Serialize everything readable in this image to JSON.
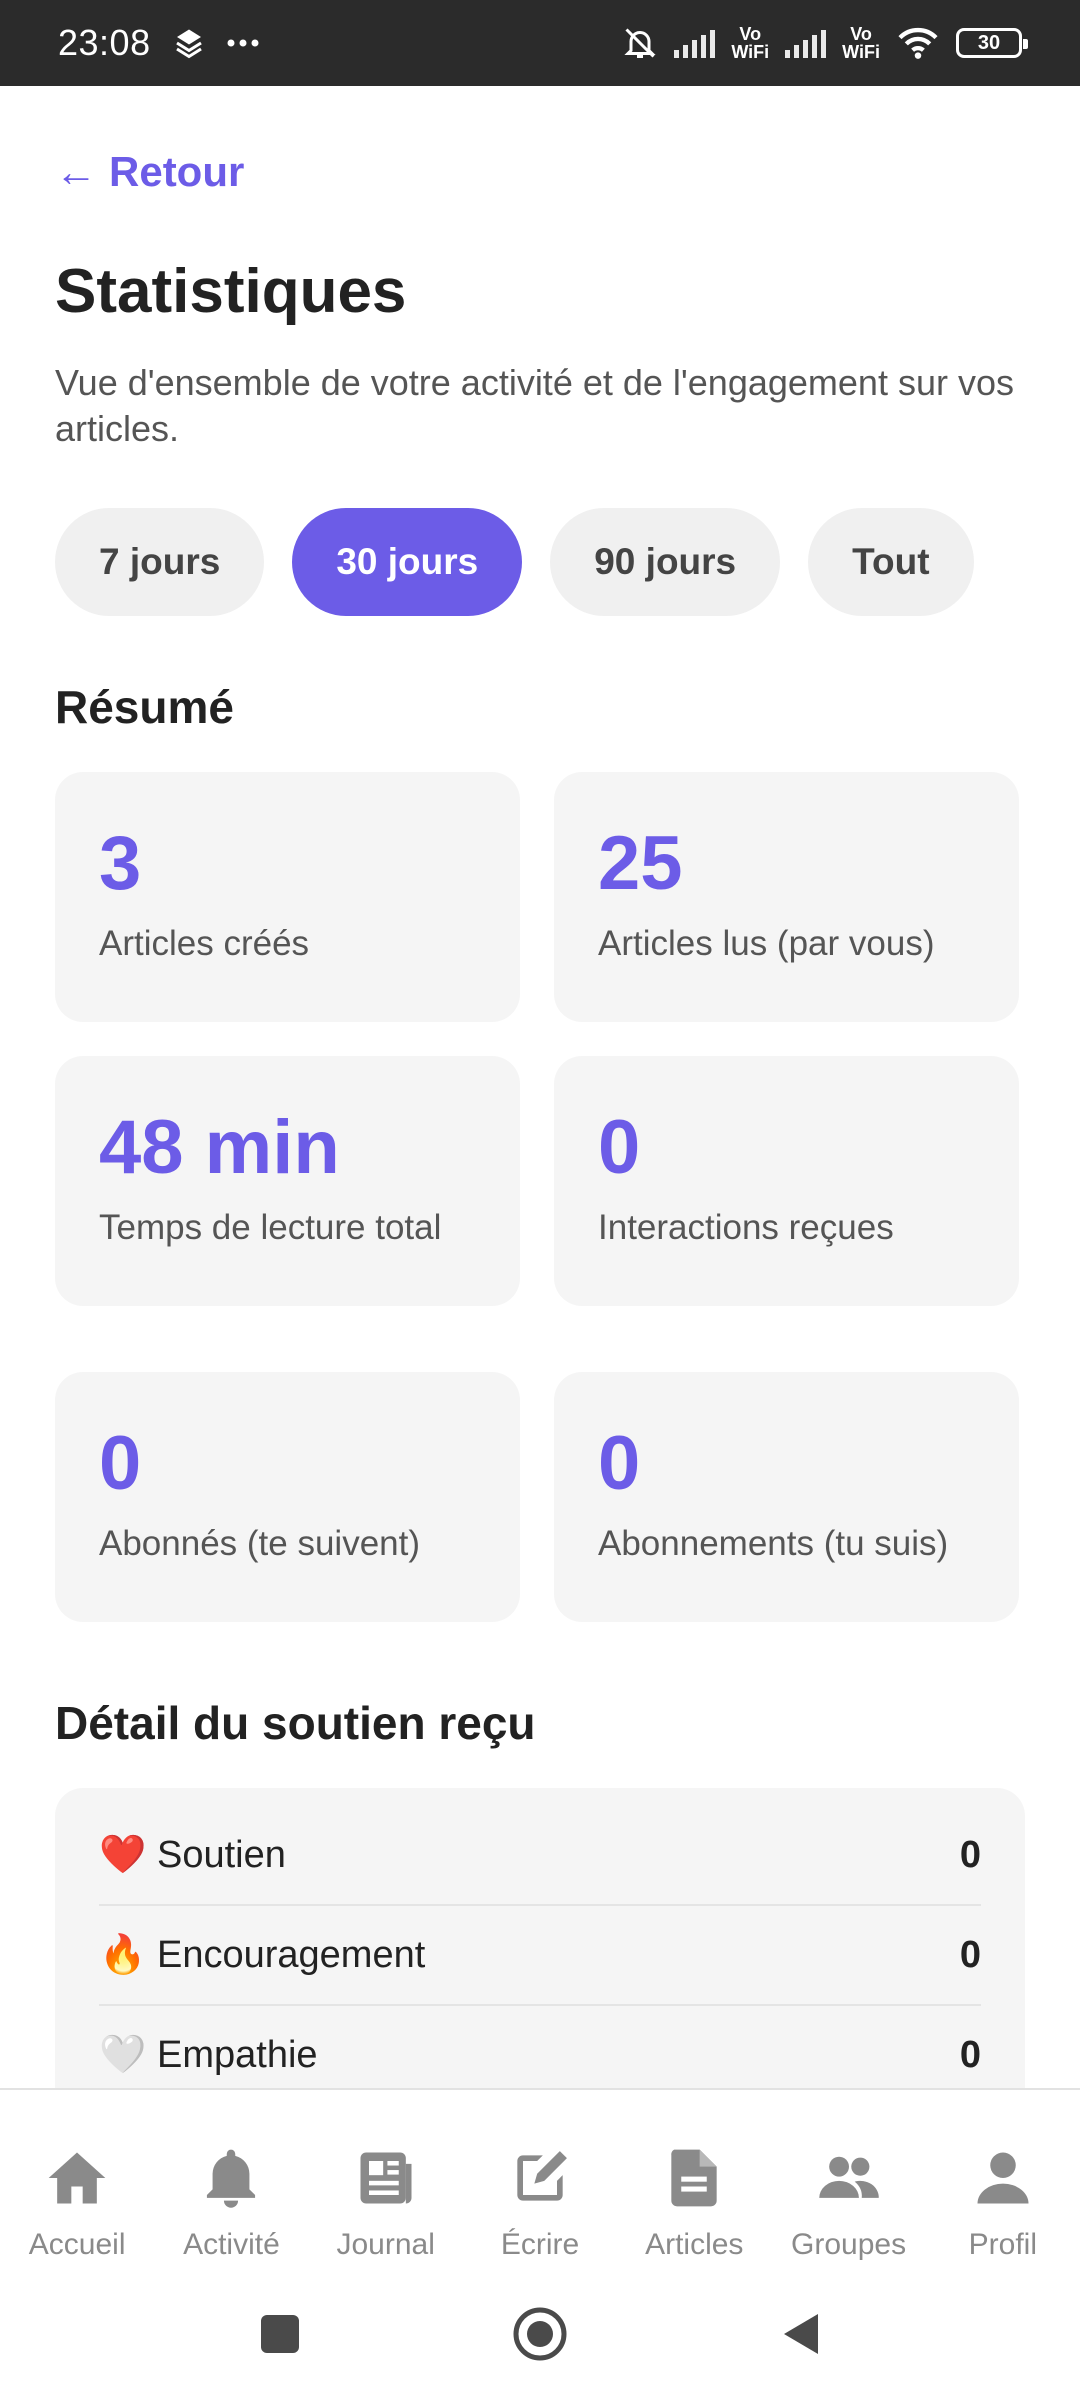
{
  "status_bar": {
    "time": "23:08",
    "battery": "30",
    "vowifi_1": "Vo\nWiFi",
    "vowifi_2": "Vo\nWiFi"
  },
  "header": {
    "back_label": "Retour",
    "title": "Statistiques",
    "subtitle": "Vue d'ensemble de votre activité et de l'engagement sur vos articles."
  },
  "filters": [
    {
      "label": "7 jours",
      "active": false
    },
    {
      "label": "30 jours",
      "active": true
    },
    {
      "label": "90 jours",
      "active": false
    },
    {
      "label": "Tout",
      "active": false
    }
  ],
  "summary": {
    "title": "Résumé",
    "cards": [
      {
        "value": "3",
        "label": "Articles créés"
      },
      {
        "value": "25",
        "label": "Articles lus (par vous)"
      },
      {
        "value": "48 min",
        "label": "Temps de lecture total"
      },
      {
        "value": "0",
        "label": "Interactions reçues"
      },
      {
        "value": "0",
        "label": "Abonnés (te suivent)"
      },
      {
        "value": "0",
        "label": "Abonnements (tu suis)"
      }
    ]
  },
  "support": {
    "title": "Détail du soutien reçu",
    "rows": [
      {
        "emoji": "❤️",
        "name": "Soutien",
        "count": "0"
      },
      {
        "emoji": "🔥",
        "name": "Encouragement",
        "count": "0"
      },
      {
        "emoji": "🤍",
        "name": "Empathie",
        "count": "0"
      }
    ]
  },
  "bottom_nav": [
    {
      "label": "Accueil",
      "icon": "home-icon"
    },
    {
      "label": "Activité",
      "icon": "bell-icon"
    },
    {
      "label": "Journal",
      "icon": "newspaper-icon"
    },
    {
      "label": "Écrire",
      "icon": "edit-icon"
    },
    {
      "label": "Articles",
      "icon": "document-icon"
    },
    {
      "label": "Groupes",
      "icon": "users-icon"
    },
    {
      "label": "Profil",
      "icon": "user-icon"
    }
  ],
  "colors": {
    "accent": "#6c5ce7",
    "card": "#f5f5f5",
    "pill": "#f0f0f0",
    "nav_icon": "#8a8a8a"
  }
}
